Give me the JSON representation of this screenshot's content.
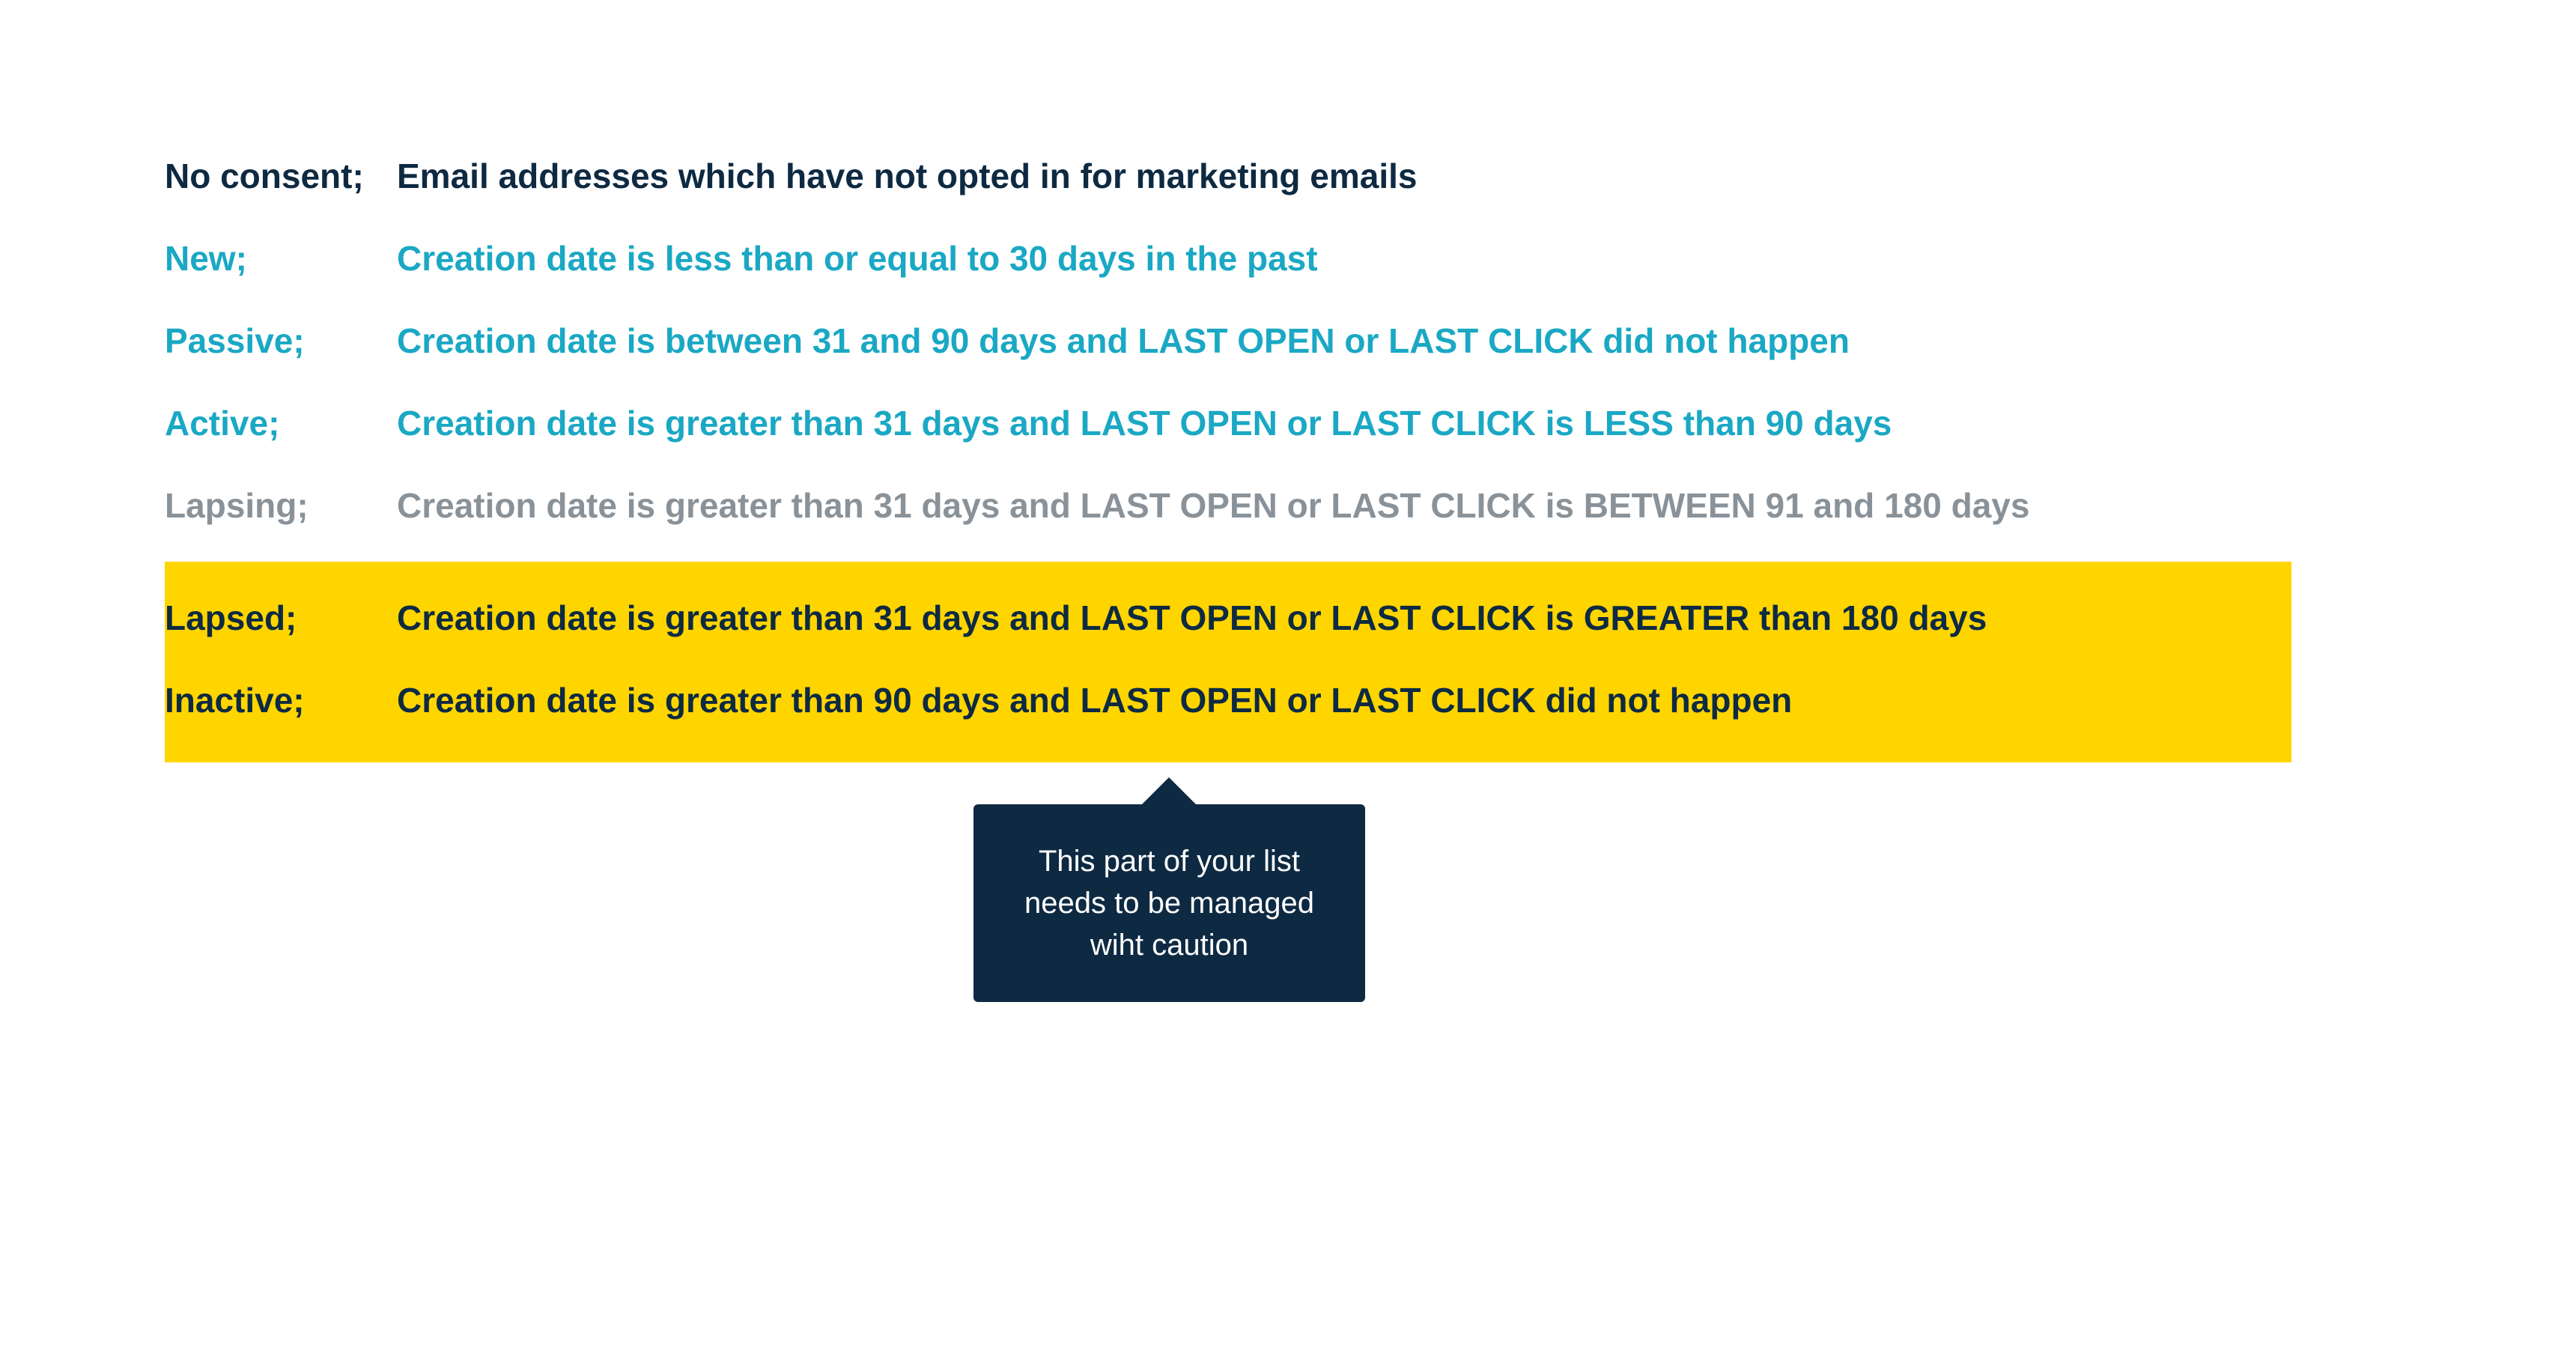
{
  "rows": [
    {
      "label": "No consent;",
      "desc": "Email addresses which have not opted in for marketing emails",
      "style": "dark"
    },
    {
      "label": "New;",
      "desc": "Creation date is less than or equal to 30 days in the past",
      "style": "teal"
    },
    {
      "label": "Passive;",
      "desc": "Creation date is between 31 and 90 days and LAST OPEN or LAST CLICK did not happen",
      "style": "teal"
    },
    {
      "label": "Active;",
      "desc": "Creation date is greater than 31 days and LAST OPEN or LAST CLICK is LESS than 90 days",
      "style": "teal"
    },
    {
      "label": "Lapsing;",
      "desc": "Creation date is greater than 31 days and LAST OPEN or LAST CLICK is BETWEEN 91 and 180 days",
      "style": "grey"
    }
  ],
  "highlighted": [
    {
      "label": "Lapsed;",
      "desc": "Creation date is greater than 31 days and LAST OPEN or LAST CLICK is GREATER than 180 days",
      "style": "dark"
    },
    {
      "label": "Inactive;",
      "desc": "Creation date is greater than 90 days and LAST OPEN or LAST CLICK did not happen",
      "style": "dark"
    }
  ],
  "callout": {
    "line1": "This part of your list",
    "line2": "needs to be managed",
    "line3": "wiht caution"
  }
}
